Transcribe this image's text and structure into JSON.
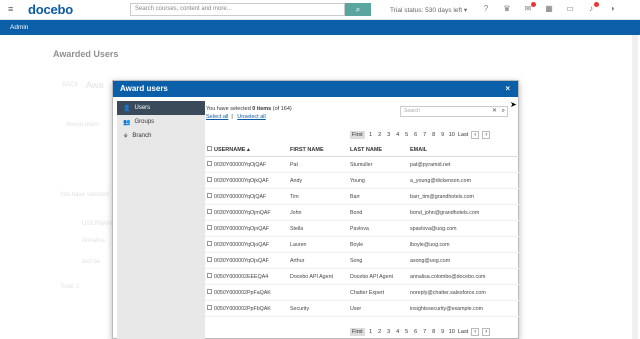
{
  "topbar": {
    "logo": "docebo",
    "search_placeholder": "Search courses, content and more...",
    "trial": "Trial status: 530 days left ▾"
  },
  "adminbar": {
    "label": "Admin"
  },
  "page": {
    "title": "Awarded Users"
  },
  "background": {
    "back": "BACK",
    "award": "Awa",
    "award_users": "Award users",
    "select_info": "You have selected",
    "username_col": "USERNAME",
    "row1": "Annalisa",
    "row2": "asd da",
    "footer": "Total: 2"
  },
  "modal": {
    "title": "Award users",
    "close": "×",
    "sidebar": [
      {
        "label": "Users",
        "icon": "user-icon"
      },
      {
        "label": "Groups",
        "icon": "groups-icon"
      },
      {
        "label": "Branch",
        "icon": "branch-icon"
      }
    ],
    "selected_prefix": "You have selected ",
    "selected_count": "0 items",
    "selected_suffix": " (of 164)",
    "select_all": "Select all",
    "unselect_all": "Unselect all",
    "search_placeholder": "Search",
    "pager": [
      "First",
      "1",
      "2",
      "3",
      "4",
      "5",
      "6",
      "7",
      "8",
      "9",
      "10",
      "Last"
    ],
    "columns": [
      "USERNAME ▴",
      "FIRST NAME",
      "LAST NAME",
      "EMAIL"
    ],
    "rows": [
      [
        "0030Y00000YqOjQAF",
        "Pat",
        "Stumuller",
        "pat@pyramid.net"
      ],
      [
        "0030Y00000YqOjkQAF",
        "Andy",
        "Young",
        "a_young@dickenson.com"
      ],
      [
        "0030Y00000YqOjQAF",
        "Tim",
        "Barr",
        "barr_tim@grandhotels.com"
      ],
      [
        "0030Y00000YqOjmQAF",
        "John",
        "Bond",
        "bond_john@grandhotels.com"
      ],
      [
        "0030Y00000YqOjnQAF",
        "Stella",
        "Pavlova",
        "spavlova@uog.com"
      ],
      [
        "0030Y00000YqOjoQAF",
        "Lauren",
        "Boyle",
        "lboyle@uog.com"
      ],
      [
        "0030Y00000YqOjsQAF",
        "Arthur",
        "Song",
        "asong@uog.com"
      ],
      [
        "0050Y000002EEEQA4",
        "Docebo API Agent",
        "Docebo API Agent",
        "annalisa.colombo@docebo.com"
      ],
      [
        "0050Y000002PpFaQAK",
        "",
        "Chatter Expert",
        "noreply@chatter.salesforce.com"
      ],
      [
        "0050Y000002PpFbQAK",
        "Security",
        "User",
        "insightssecurity@example.com"
      ]
    ]
  }
}
